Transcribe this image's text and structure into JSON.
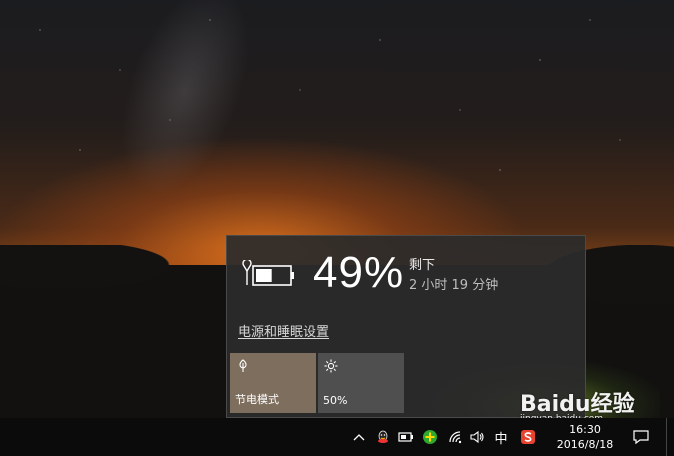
{
  "battery": {
    "percent": "49%",
    "level": 0.49,
    "remaining_label": "剩下",
    "remaining_time": "2 小时 19 分钟",
    "settings_link": "电源和睡眠设置"
  },
  "quick_actions": [
    {
      "label": "节电模式",
      "icon": "leaf-icon",
      "color": "#7d6e5e"
    },
    {
      "label": "50%",
      "icon": "sun-icon",
      "color": "#4f4f4f"
    }
  ],
  "taskbar": {
    "ime": "中",
    "time": "16:30",
    "date": "2016/8/18",
    "icons": [
      "chevron-up-icon",
      "qq-icon",
      "battery-icon",
      "green-plus-icon",
      "wifi-icon",
      "volume-icon",
      "sogou-icon",
      "notification-icon"
    ]
  },
  "watermark": {
    "brand": "Baidu经验",
    "url": "jingyan.baidu.com"
  }
}
